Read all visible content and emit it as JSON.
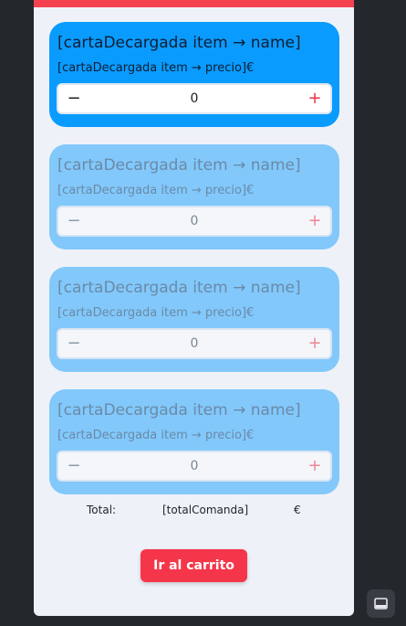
{
  "cards": [
    {
      "name": "[cartaDecargada item → name]",
      "price": "[cartaDecargada item → precio]€",
      "qty": "0",
      "minus": "−",
      "plus": "+",
      "state": "active"
    },
    {
      "name": "[cartaDecargada item → name]",
      "price": "[cartaDecargada item → precio]€",
      "qty": "0",
      "minus": "−",
      "plus": "+",
      "state": "faded"
    },
    {
      "name": "[cartaDecargada item → name]",
      "price": "[cartaDecargada item → precio]€",
      "qty": "0",
      "minus": "−",
      "plus": "+",
      "state": "faded"
    },
    {
      "name": "[cartaDecargada item → name]",
      "price": "[cartaDecargada item → precio]€",
      "qty": "0",
      "minus": "−",
      "plus": "+",
      "state": "faded"
    }
  ],
  "total": {
    "label": "Total:",
    "value": "[totalComanda]",
    "currency": "€"
  },
  "cart_button": "Ir al carrito",
  "colors": {
    "accent_red": "#f5364a",
    "card_active": "#0a9bff",
    "card_faded": "#82c8fb"
  },
  "side_button_icon": "panel-bottom-icon"
}
